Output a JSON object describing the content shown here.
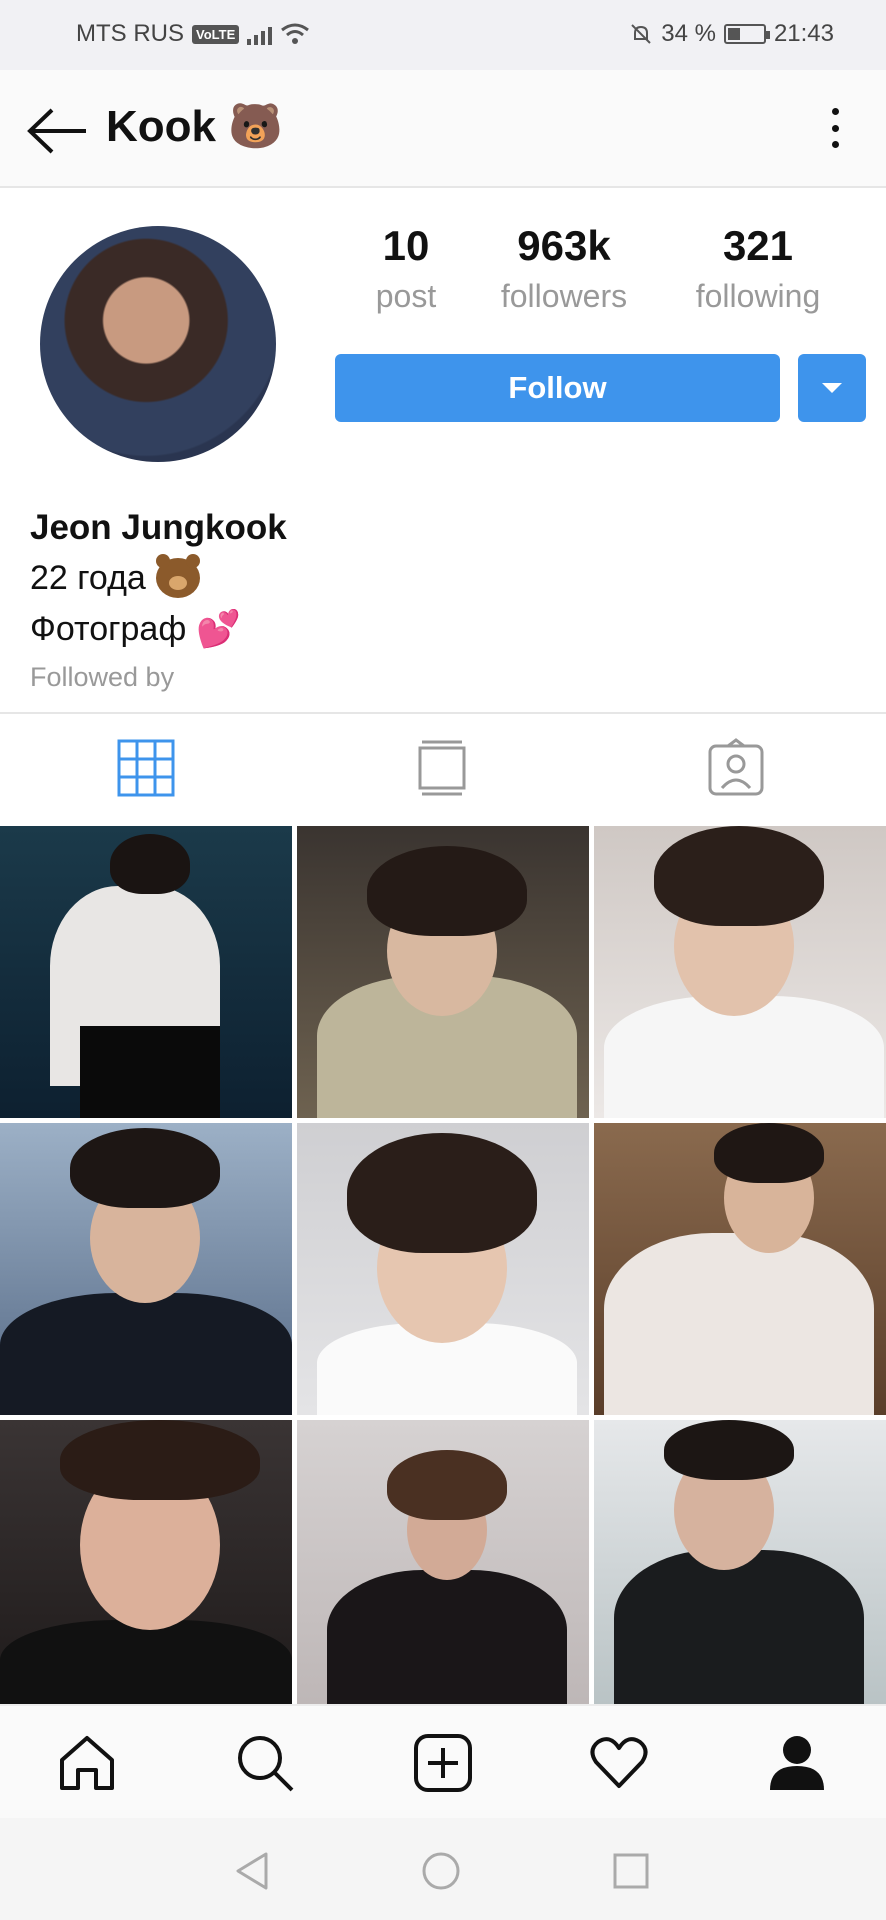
{
  "status_bar": {
    "carrier": "MTS RUS",
    "network_badge": "VoLTE",
    "battery_percent": "34 %",
    "battery_level": 0.34,
    "time": "21:43"
  },
  "header": {
    "title": "Kook 🐻",
    "back_icon": "arrow-left-icon",
    "more_icon": "more-vertical-icon"
  },
  "profile": {
    "stats": [
      {
        "value": "10",
        "label": "post"
      },
      {
        "value": "963k",
        "label": "followers"
      },
      {
        "value": "321",
        "label": "following"
      }
    ],
    "follow_label": "Follow",
    "name": "Jeon Jungkook",
    "bio_line1": "22 года",
    "bio_line2": "Фотограф",
    "followed_by": "Followed by"
  },
  "tabs": [
    {
      "icon": "grid-icon",
      "active": true
    },
    {
      "icon": "feed-icon",
      "active": false
    },
    {
      "icon": "tagged-user-icon",
      "active": false
    }
  ],
  "bottom_nav": [
    {
      "icon": "home-icon"
    },
    {
      "icon": "search-icon"
    },
    {
      "icon": "add-post-icon"
    },
    {
      "icon": "heart-icon"
    },
    {
      "icon": "profile-icon"
    }
  ],
  "colors": {
    "accent": "#3e94ec",
    "muted_text": "#999999",
    "status_bar_bg": "#f1f1f4"
  }
}
